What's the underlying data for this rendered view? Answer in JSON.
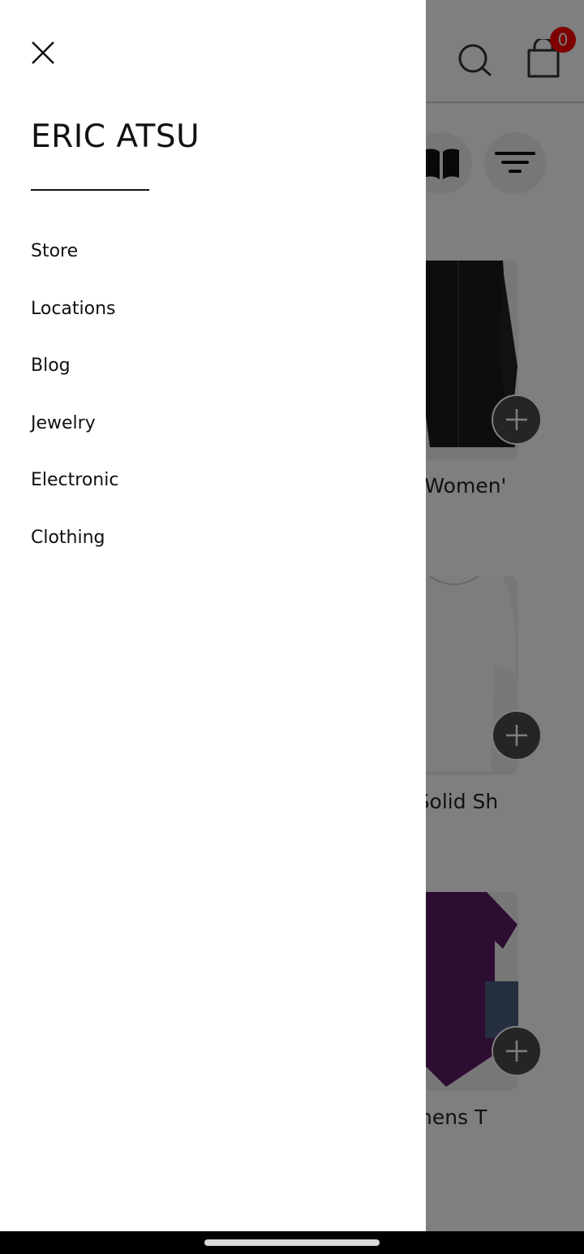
{
  "header": {
    "cart_count": "0",
    "icons": [
      "search-icon",
      "shopping-bag-icon"
    ]
  },
  "toolbar": {
    "icons": [
      "book-icon",
      "filter-icon"
    ]
  },
  "products": [
    {
      "title": "ove Women'",
      "image": "black-jacket"
    },
    {
      "title": "n's Solid Sh",
      "image": "white-top"
    },
    {
      "title": "Womens T",
      "image": "purple-tshirt"
    }
  ],
  "drawer": {
    "title": "ERIC ATSU",
    "menu": [
      "Store",
      "Locations",
      "Blog",
      "Jewelry",
      "Electronic",
      "Clothing"
    ]
  },
  "colors": {
    "badge": "#ff0000",
    "scrim": "rgba(0,0,0,0.5)",
    "text": "#111111"
  }
}
